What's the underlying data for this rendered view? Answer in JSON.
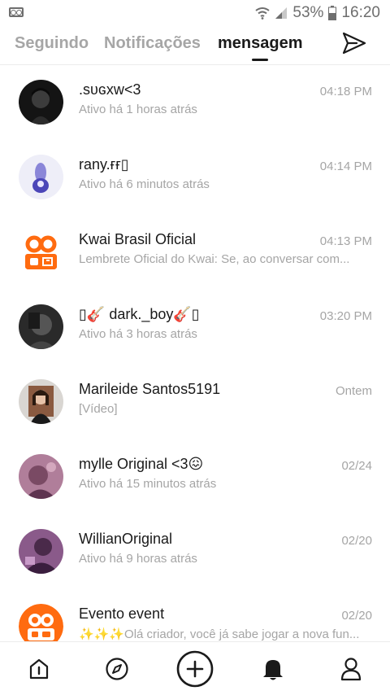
{
  "status_bar": {
    "wifi_icon": "wifi-icon",
    "signal_icon": "signal-icon",
    "battery_text": "53%",
    "battery_icon": "battery-icon",
    "time": "16:20"
  },
  "tabs": {
    "items": [
      {
        "label": "Seguindo",
        "active": false
      },
      {
        "label": "Notificações",
        "active": false
      },
      {
        "label": "mensagem",
        "active": true
      }
    ],
    "send_icon": "send-icon"
  },
  "colors": {
    "kwai_orange": "#ff6b10",
    "text_primary": "#1a1a1a",
    "text_secondary": "#a5a5a5"
  },
  "messages": [
    {
      "name": ".sᴜɢxw<3",
      "preview": "Ativo há 1 horas atrás",
      "time": "04:18 PM"
    },
    {
      "name": "rany.ғғ▯",
      "preview": "Ativo há 6 minutos atrás",
      "time": "04:14 PM"
    },
    {
      "name": "Kwai Brasil Oficial",
      "preview": "Lembrete Oficial do Kwai: Se, ao conversar com...",
      "time": "04:13 PM"
    },
    {
      "name": "▯🎸 dark._boy🎸▯",
      "preview": "Ativo há 3 horas atrás",
      "time": "03:20 PM"
    },
    {
      "name": "Marileide Santos5191",
      "preview": "[Vídeo]",
      "time": "Ontem"
    },
    {
      "name": "mylle Original <3😖",
      "preview": "Ativo há 15 minutos atrás",
      "time": "02/24"
    },
    {
      "name": "WillianOriginal",
      "preview": "Ativo há 9 horas atrás",
      "time": "02/20"
    },
    {
      "name": "Evento event",
      "preview": "✨✨✨Olá criador, você já sabe jogar a nova fun...",
      "time": "02/20"
    }
  ],
  "bottom_nav": [
    {
      "icon": "home-icon"
    },
    {
      "icon": "discover-icon"
    },
    {
      "icon": "add-icon"
    },
    {
      "icon": "bell-icon"
    },
    {
      "icon": "profile-icon"
    }
  ]
}
